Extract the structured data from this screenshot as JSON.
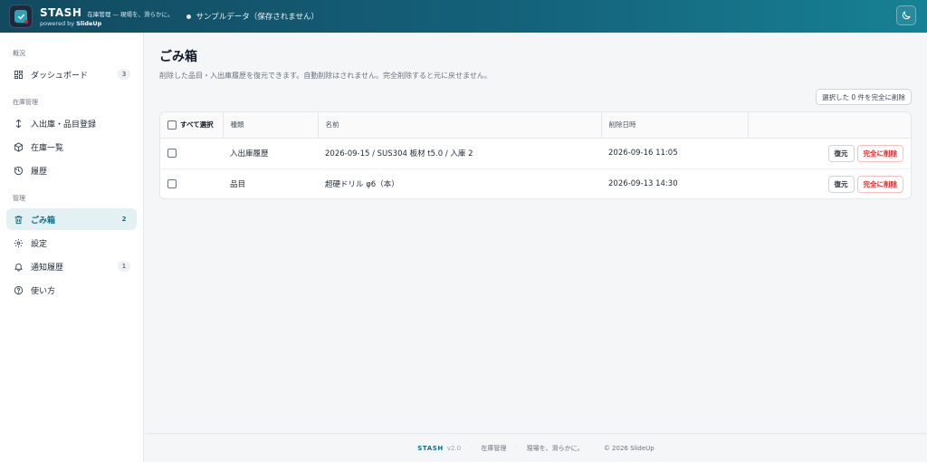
{
  "header": {
    "brand": "STASH",
    "tagline": "在庫管理 — 現場を、滑らかに。",
    "powered_prefix": "powered by ",
    "powered_name": "SlideUp",
    "sample_status": "サンプルデータ（保存されません）"
  },
  "sidebar": {
    "sections": [
      {
        "title": "概況"
      },
      {
        "title": "在庫管理"
      },
      {
        "title": "管理"
      }
    ],
    "items": [
      {
        "label": "ダッシュボード",
        "badge": "3",
        "icon": "grid-icon"
      },
      {
        "label": "入出庫・品目登録",
        "icon": "arrows-updown-icon"
      },
      {
        "label": "在庫一覧",
        "icon": "box-icon"
      },
      {
        "label": "履歴",
        "icon": "history-icon"
      },
      {
        "label": "ごみ箱",
        "badge": "2",
        "icon": "trash-icon",
        "active": true
      },
      {
        "label": "設定",
        "icon": "gear-icon"
      },
      {
        "label": "通知履歴",
        "badge": "1",
        "icon": "bell-icon"
      },
      {
        "label": "使い方",
        "icon": "help-icon"
      }
    ]
  },
  "main": {
    "title": "ごみ箱",
    "description": "削除した品目・入出庫履歴を復元できます。自動削除はされません。完全削除すると元に戻せません。",
    "bulk_delete_label": "選択した 0 件を完全に削除",
    "table": {
      "select_all_label": "すべて選択",
      "columns": [
        "種類",
        "名前",
        "削除日時",
        ""
      ],
      "rows": [
        {
          "type": "入出庫履歴",
          "name": "2026-09-15 / SUS304 板材 t5.0 / 入庫 2",
          "deleted_at": "2026-09-16 11:05"
        },
        {
          "type": "品目",
          "name": "超硬ドリル φ6（本）",
          "deleted_at": "2026-09-13 14:30"
        }
      ],
      "restore_label": "復元",
      "delete_label": "完全に削除"
    }
  },
  "footer": {
    "brand": "STASH",
    "version": "v2.0",
    "category": "在庫管理",
    "tagline": "現場を、滑らかに。",
    "copyright": "© 2026 SlideUp"
  },
  "colors": {
    "header_start": "#124a60",
    "header_end": "#178194",
    "accent": "#0f6f86",
    "danger": "#dc2626",
    "active_bg": "#e3f1f5"
  }
}
